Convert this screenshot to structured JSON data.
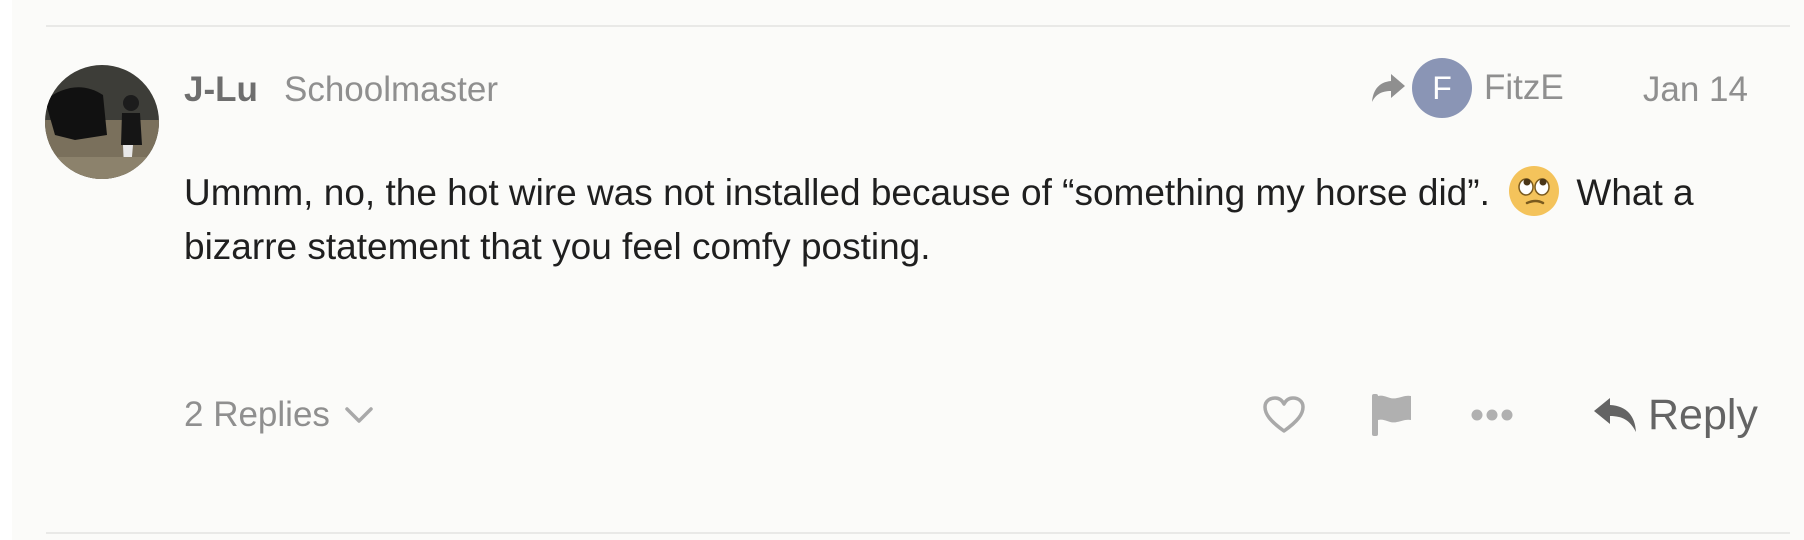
{
  "post": {
    "author": "J-Lu",
    "user_title": "Schoolmaster",
    "reply_to": {
      "avatar_letter": "F",
      "username": "FitzE",
      "avatar_color": "#8a95b5"
    },
    "date": "Jan 14",
    "body_before_emoji": "Ummm, no, the hot wire was not installed because of “something my horse did”.",
    "emoji": "roll_eyes",
    "body_after_emoji": "What a bizarre statement that you feel comfy posting."
  },
  "footer": {
    "replies_label": "2 Replies",
    "reply_label": "Reply"
  },
  "icons": {
    "reply_to": "share-arrow-icon",
    "like": "heart-icon",
    "flag": "flag-icon",
    "more": "ellipsis-icon",
    "reply": "reply-arrow-icon",
    "expand": "chevron-down-icon"
  },
  "colors": {
    "background": "#fbfbf9",
    "text": "#1f1f1f",
    "muted": "#8f8f8f",
    "author": "#6e6e6e",
    "icon": "#a9a9a9"
  }
}
